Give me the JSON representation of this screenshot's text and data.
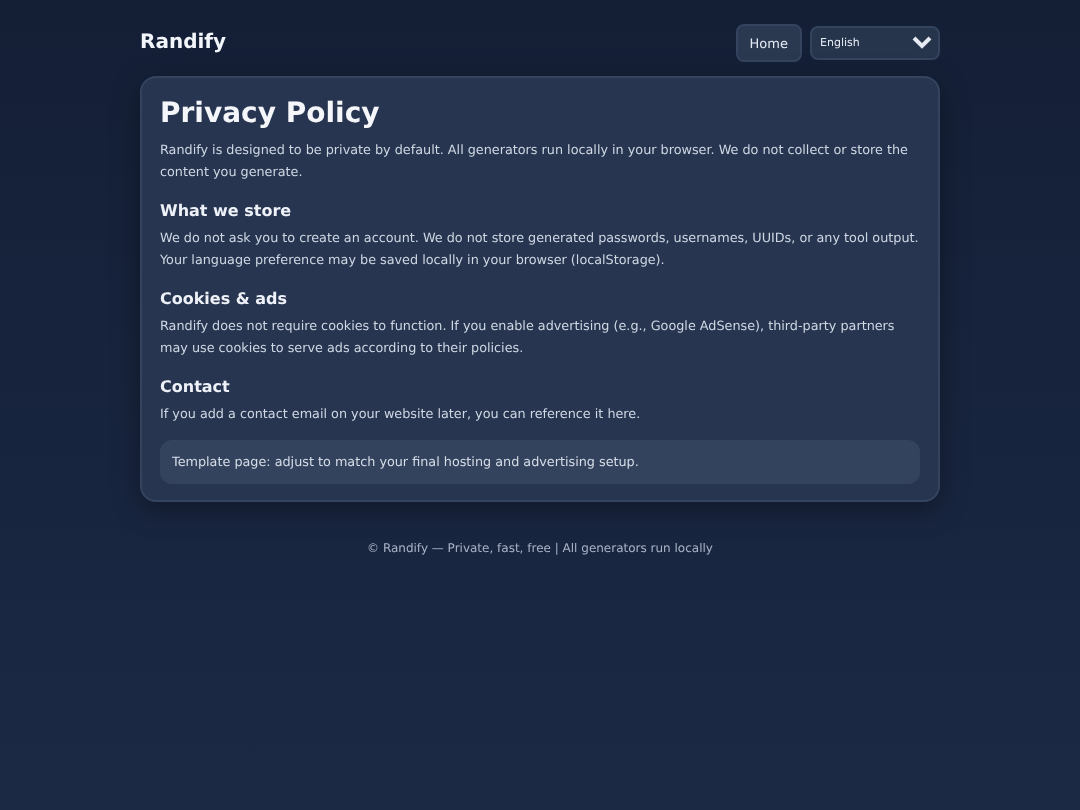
{
  "header": {
    "brand": "Randify",
    "nav": [
      {
        "label": "Home"
      }
    ],
    "language": {
      "value": "English"
    }
  },
  "card": {
    "title": "Privacy Policy",
    "sections": [
      {
        "kind": "paragraph",
        "text": "Randify is designed to be private by default. All generators run locally in your browser. We do not collect or store the content you generate."
      },
      {
        "kind": "heading",
        "text": "What we store"
      },
      {
        "kind": "paragraph",
        "text": "We do not ask you to create an account. We do not store generated passwords, usernames, UUIDs, or any tool output. Your language preference may be saved locally in your browser (localStorage)."
      },
      {
        "kind": "heading",
        "text": "Cookies & ads"
      },
      {
        "kind": "paragraph",
        "text": "Randify does not require cookies to function. If you enable advertising (e.g., Google AdSense), third-party partners may use cookies to serve ads according to their policies."
      },
      {
        "kind": "heading",
        "text": "Contact"
      },
      {
        "kind": "paragraph",
        "text": "If you add a contact email on your website later, you can reference it here."
      },
      {
        "kind": "note",
        "text": "Template page: adjust to match your final hosting and advertising setup."
      }
    ]
  },
  "footer": {
    "text": "© Randify — Private, fast, free | All generators run locally"
  }
}
